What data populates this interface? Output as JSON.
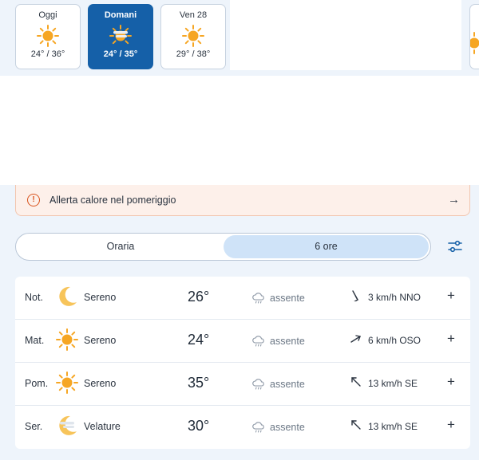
{
  "days": [
    {
      "name": "Oggi",
      "temp": "24° / 36°",
      "icon": "sun-icon",
      "active": false
    },
    {
      "name": "Domani",
      "temp": "24° / 35°",
      "icon": "sun-haze-icon",
      "active": true
    },
    {
      "name": "Ven 28",
      "temp": "29° / 38°",
      "icon": "sun-icon",
      "active": false
    }
  ],
  "alert": {
    "text": "Allerta calore nel pomeriggio",
    "icon": "warning-icon"
  },
  "tabs": {
    "hourly": "Oraria",
    "six_hours": "6 ore",
    "selected": "6 ore"
  },
  "forecast": [
    {
      "period": "Not.",
      "condition": "Sereno",
      "icon": "moon-icon",
      "temp": "26°",
      "rain": "assente",
      "wind": "3 km/h NNO",
      "wind_arrow": "arrow-down-left-icon"
    },
    {
      "period": "Mat.",
      "condition": "Sereno",
      "icon": "sun-icon",
      "temp": "24°",
      "rain": "assente",
      "wind": "6 km/h OSO",
      "wind_arrow": "arrow-up-right-icon"
    },
    {
      "period": "Pom.",
      "condition": "Sereno",
      "icon": "sun-icon",
      "temp": "35°",
      "rain": "assente",
      "wind": "13 km/h SE",
      "wind_arrow": "arrow-up-left-icon"
    },
    {
      "period": "Ser.",
      "condition": "Velature",
      "icon": "moon-haze-icon",
      "temp": "30°",
      "rain": "assente",
      "wind": "13 km/h SE",
      "wind_arrow": "arrow-up-left-icon"
    }
  ],
  "colors": {
    "accent": "#1560a8",
    "selected_tab": "#cfe3f8",
    "alert_bg": "#fdf0ea",
    "alert_icon": "#d9541e",
    "sun": "#f6a623"
  }
}
